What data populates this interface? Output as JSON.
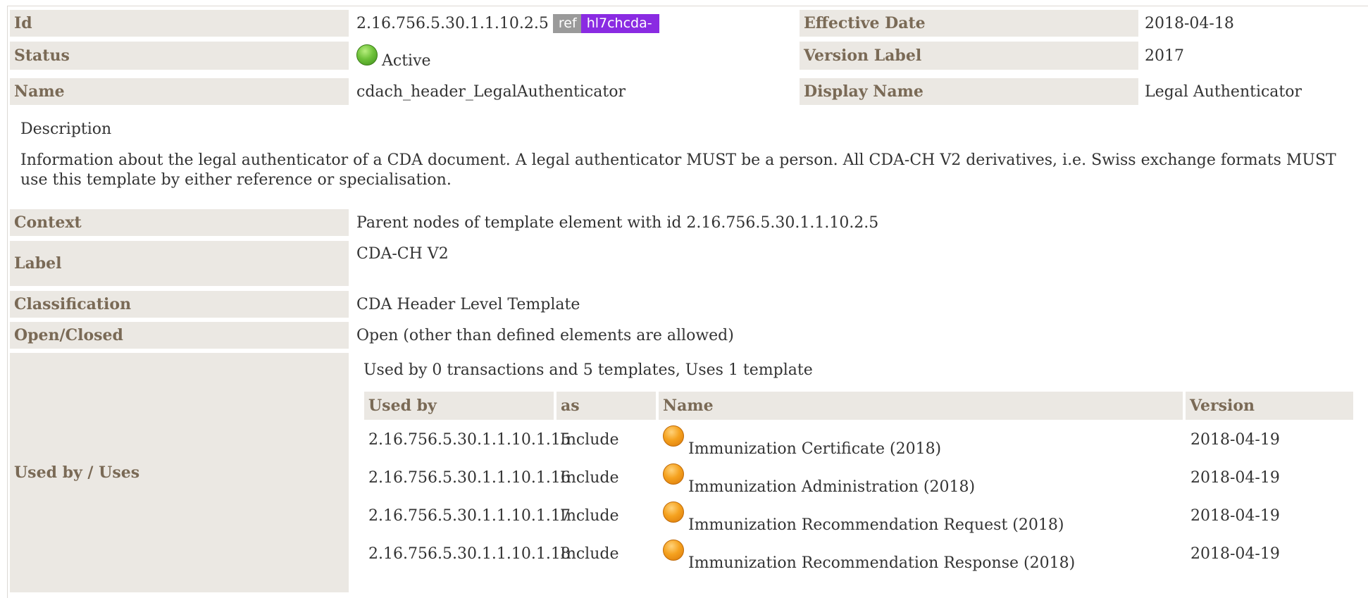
{
  "header": {
    "id_label": "Id",
    "id_value": "2.16.756.5.30.1.1.10.2.5",
    "ref_badge": "ref",
    "prefix_badge": "hl7chcda-",
    "effective_date_label": "Effective Date",
    "effective_date_value": "2018-04-18",
    "status_label": "Status",
    "status_value": "Active",
    "version_label_label": "Version Label",
    "version_label_value": "2017",
    "name_label": "Name",
    "name_value": "cdach_header_LegalAuthenticator",
    "display_name_label": "Display Name",
    "display_name_value": "Legal Authenticator"
  },
  "description": {
    "label": "Description",
    "text": "Information about the legal authenticator of a CDA document. A legal authenticator MUST be a person. All CDA-CH V2 derivatives, i.e. Swiss exchange formats MUST use this template by either reference or specialisation."
  },
  "details": {
    "context_label": "Context",
    "context_value": "Parent nodes of template element with id 2.16.756.5.30.1.1.10.2.5",
    "label_label": "Label",
    "label_value": "CDA-CH V2",
    "classification_label": "Classification",
    "classification_value": "CDA Header Level Template",
    "open_closed_label": "Open/Closed",
    "open_closed_value": "Open (other than defined elements are allowed)",
    "used_by_label": "Used by / Uses"
  },
  "usage": {
    "summary": "Used by 0 transactions and 5 templates, Uses 1 template",
    "columns": [
      "Used by",
      "as",
      "Name",
      "Version"
    ],
    "rows": [
      {
        "id": "2.16.756.5.30.1.1.10.1.15",
        "as": "Include",
        "name": "Immunization Certificate (2018)",
        "version": "2018-04-19"
      },
      {
        "id": "2.16.756.5.30.1.1.10.1.16",
        "as": "Include",
        "name": "Immunization Administration (2018)",
        "version": "2018-04-19"
      },
      {
        "id": "2.16.756.5.30.1.1.10.1.17",
        "as": "Include",
        "name": "Immunization Recommendation Request (2018)",
        "version": "2018-04-19"
      },
      {
        "id": "2.16.756.5.30.1.1.10.1.18",
        "as": "Include",
        "name": "Immunization Recommendation Response (2018)",
        "version": "2018-04-19"
      }
    ]
  },
  "colors": {
    "label_bg": "#ebe8e3",
    "label_text": "#7a6a56",
    "ref_badge_bg": "#9a9a9a",
    "prefix_badge_bg": "#8a2be2",
    "status_active": "#6fc23a",
    "status_draft": "#f5a21f"
  },
  "icons": {
    "status_active": "green-circle-icon",
    "status_draft": "orange-circle-icon"
  }
}
